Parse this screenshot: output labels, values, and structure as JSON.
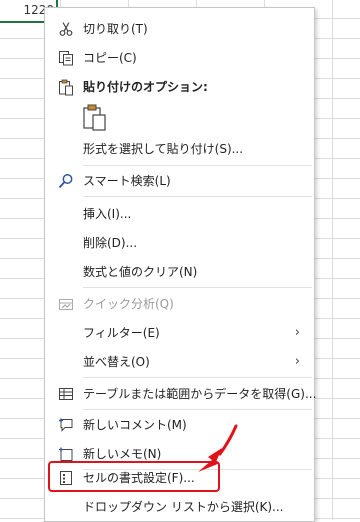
{
  "sheet": {
    "active_cell_value": "1220"
  },
  "menu": {
    "cut_label": "切り取り(T)",
    "copy_label": "コピー(C)",
    "paste_options_label": "貼り付けのオプション:",
    "paste_special_label": "形式を選択して貼り付け(S)...",
    "smart_lookup_label": "スマート検索(L)",
    "insert_label": "挿入(I)...",
    "delete_label": "削除(D)...",
    "clear_contents_label": "数式と値のクリア(N)",
    "quick_analysis_label": "クイック分析(Q)",
    "filter_label": "フィルター(E)",
    "sort_label": "並べ替え(O)",
    "get_data_label": "テーブルまたは範囲からデータを取得(G)...",
    "new_comment_label": "新しいコメント(M)",
    "new_note_label": "新しいメモ(N)",
    "format_cells_label": "セルの書式設定(F)...",
    "dropdown_pick_label": "ドロップダウン リストから選択(K)..."
  },
  "colors": {
    "highlight": "#e0121a",
    "cell_border": "#217346",
    "icon_blue": "#2b579a"
  }
}
